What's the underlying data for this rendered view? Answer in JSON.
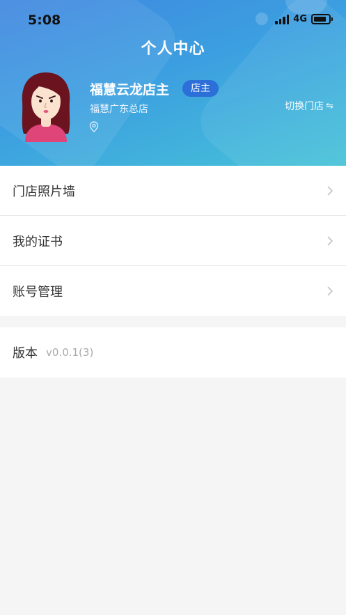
{
  "status_bar": {
    "time": "5:08",
    "network": "4G"
  },
  "header": {
    "title": "个人中心",
    "store_name": "福慧云龙店主",
    "role_badge": "店主",
    "branch": "福慧广东总店",
    "switch_store_label": "切换门店",
    "switch_icon": "⇋"
  },
  "menu": {
    "items": [
      {
        "label": "门店照片墙"
      },
      {
        "label": "我的证书"
      },
      {
        "label": "账号管理"
      }
    ]
  },
  "version": {
    "label": "版本",
    "value": "v0.0.1(3)"
  },
  "colors": {
    "header_start": "#3f86e0",
    "header_end": "#46c3d8",
    "badge": "#2d6fd8"
  }
}
